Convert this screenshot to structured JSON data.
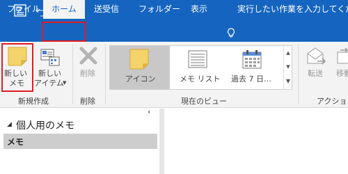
{
  "tabs": [
    {
      "label": "ファイル"
    },
    {
      "label": "ホーム"
    },
    {
      "label": "送受信"
    },
    {
      "label": "フォルダー"
    },
    {
      "label": "表示"
    }
  ],
  "tell_me": {
    "text": "実行したい作業を入力してください"
  },
  "ribbon": {
    "new_note": {
      "line1": "新しい",
      "line2": "メモ"
    },
    "new_items": {
      "line1": "新しい",
      "line2": "アイテム"
    },
    "delete": {
      "label": "削除"
    },
    "group_new": "新規作成",
    "group_delete": "削除",
    "views": [
      {
        "label": "アイコン"
      },
      {
        "label": "メモ リスト"
      },
      {
        "label": "過去 7 日…"
      }
    ],
    "group_current_view": "現在のビュー",
    "forward": {
      "label": "転送"
    },
    "move": {
      "label": "移動"
    },
    "group_actions": "アクション"
  },
  "folder_pane": {
    "section_title": "個人用のメモ",
    "items": [
      {
        "label": "メモ"
      }
    ]
  },
  "colors": {
    "title_bar": "#1565c0",
    "highlight": "#e01b24",
    "note_yellow": "#f5d36b"
  }
}
